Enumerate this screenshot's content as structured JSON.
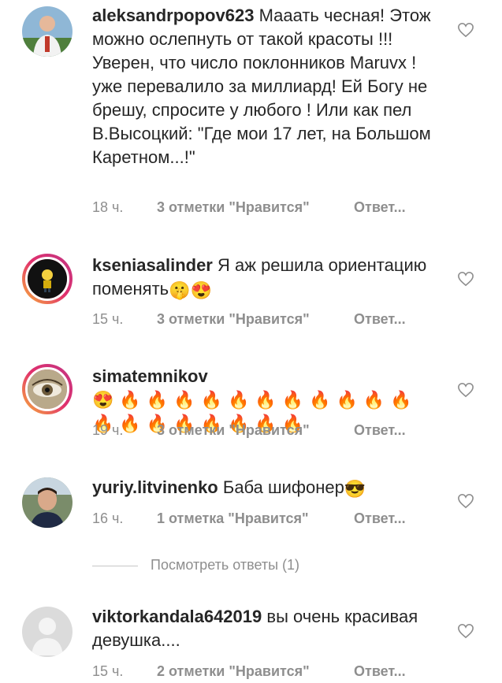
{
  "comments": [
    {
      "username": "aleksandrpopov623",
      "text": "Мааать чесная! Этож можно ослепнуть от такой красоты !!! Уверен, что число поклонников Maruvx ! уже перевалило за миллиард! Ей Богу не брешу, спросите у любого ! Или как пел В.Высоцкий: \"Где мои 17 лет, на Большом Каретном...!\"",
      "time": "18 ч.",
      "likes": "3 отметки \"Нравится\"",
      "reply": "Ответ..."
    },
    {
      "username": "kseniasalinder",
      "text": "Я аж решила ориентацию поменять",
      "emoji": "🤫😍",
      "time": "15 ч.",
      "likes": "3 отметки \"Нравится\"",
      "reply": "Ответ..."
    },
    {
      "username": "simatemnikov",
      "text": "",
      "emoji": "😍🔥🔥🔥🔥🔥🔥🔥🔥🔥🔥🔥🔥🔥🔥🔥🔥🔥🔥🔥",
      "time": "19 ч.",
      "likes": "3 отметки \"Нравится\"",
      "reply": "Ответ..."
    },
    {
      "username": "yuriy.litvinenko",
      "text": "Баба шифонер",
      "emoji": "😎",
      "time": "16 ч.",
      "likes": "1 отметка \"Нравится\"",
      "reply": "Ответ..."
    },
    {
      "username": "viktorkandala642019",
      "text": "вы очень красивая девушка....",
      "time": "15 ч.",
      "likes": "2 отметки \"Нравится\"",
      "reply": "Ответ..."
    }
  ],
  "view_replies": "Посмотреть ответы (1)",
  "icons": {
    "like": "heart-outline-icon",
    "default_avatar": "user-silhouette-icon"
  },
  "colors": {
    "text": "#262626",
    "meta": "#8e8e8e",
    "story_ring": "#e1306c"
  }
}
